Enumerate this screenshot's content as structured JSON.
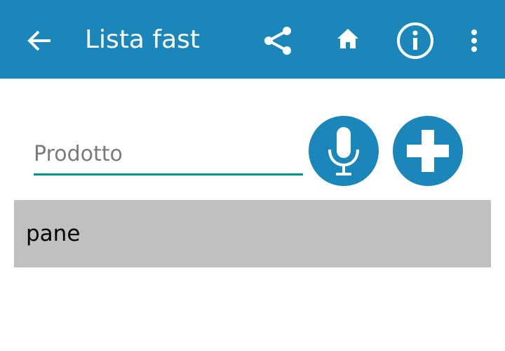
{
  "toolbar": {
    "title": "Lista fast",
    "color": "#1b86b9"
  },
  "form": {
    "placeholder": "Prodotto",
    "value": ""
  },
  "list": {
    "items": [
      {
        "label": "pane"
      }
    ]
  }
}
